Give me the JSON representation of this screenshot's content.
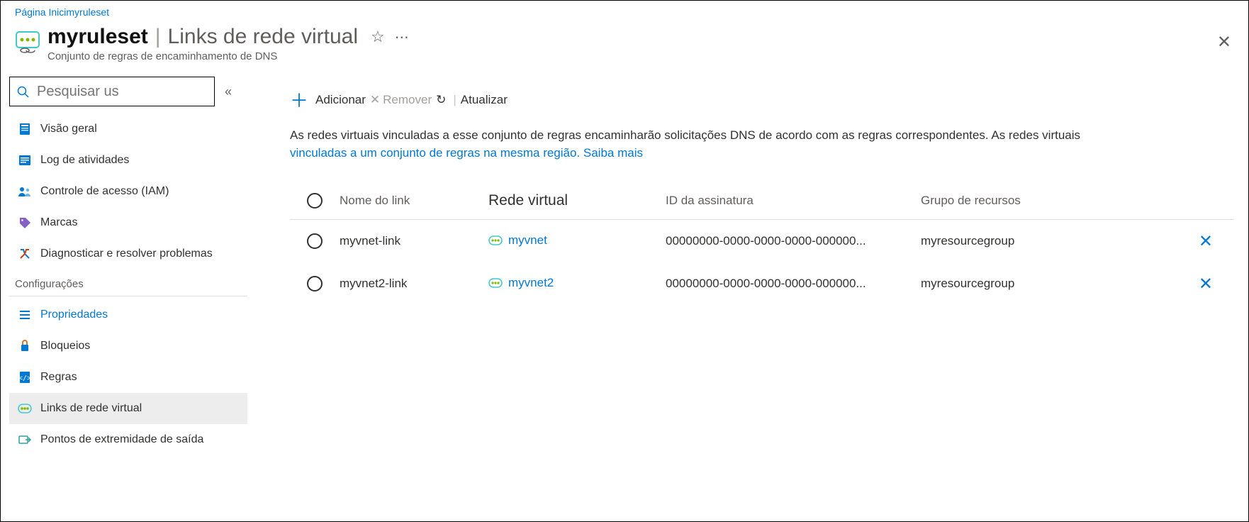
{
  "breadcrumb": {
    "home": "Página Inici",
    "current": "myruleset"
  },
  "header": {
    "title_main": "myruleset",
    "title_sub": "Links de rede virtual",
    "subtitle": "Conjunto de regras de encaminhamento de DNS"
  },
  "sidebar": {
    "search_placeholder": "Pesquisar us",
    "items": {
      "overview": "Visão geral",
      "activity": "Log de atividades",
      "iam": "Controle de acesso (IAM)",
      "tags": "Marcas",
      "diagnose": "Diagnosticar e resolver problemas"
    },
    "section_settings": "Configurações",
    "settings": {
      "properties": "Propriedades",
      "locks": "Bloqueios",
      "rules": "Regras",
      "vnet_links": "Links de rede virtual",
      "outbound": "Pontos de extremidade de saída"
    }
  },
  "commands": {
    "add": "Adicionar",
    "remove": "Remover",
    "refresh": "Atualizar"
  },
  "description": {
    "line1": "As redes virtuais vinculadas a esse conjunto de regras encaminharão solicitações DNS de acordo com as regras correspondentes. As redes virtuais",
    "line2_link": "vinculadas a um conjunto de regras na mesma região. Saiba mais"
  },
  "table": {
    "headers": {
      "link_name": "Nome do link",
      "vnet": "Rede virtual",
      "sub_id": "ID da assinatura",
      "rg": "Grupo de recursos"
    },
    "rows": [
      {
        "link_name": "myvnet-link",
        "vnet": "myvnet",
        "sub_id": "00000000-0000-0000-0000-000000...",
        "rg": "myresourcegroup"
      },
      {
        "link_name": "myvnet2-link",
        "vnet": "myvnet2",
        "sub_id": "00000000-0000-0000-0000-000000...",
        "rg": "myresourcegroup"
      }
    ]
  }
}
